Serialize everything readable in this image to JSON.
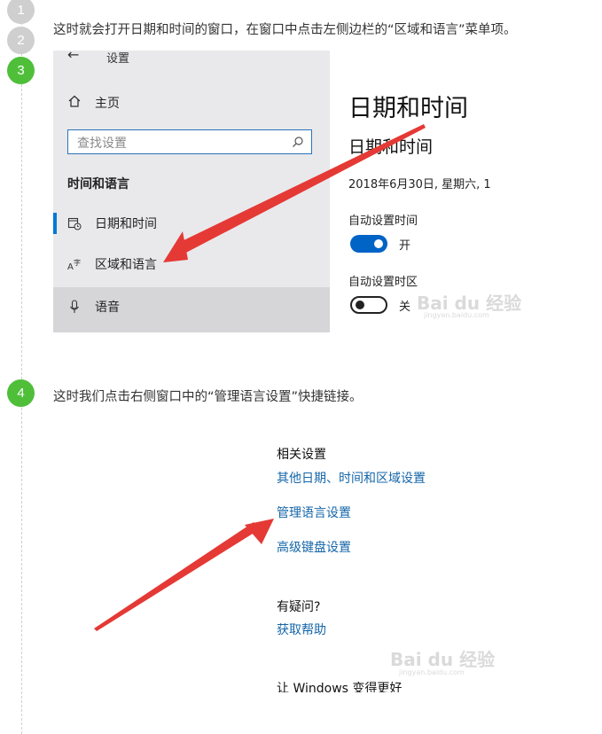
{
  "steps": [
    {
      "number": "1"
    },
    {
      "number": "2"
    },
    {
      "number": "3",
      "instruction": "这时就会打开日期和时间的窗口，在窗口中点击左侧边栏的“区域和语言”菜单项。"
    },
    {
      "number": "4",
      "instruction": "这时我们点击右侧窗口中的“管理语言设置”快捷链接。"
    }
  ],
  "settings_window": {
    "title": "设置",
    "home_label": "主页",
    "search_placeholder": "查找设置",
    "category_title": "时间和语言",
    "nav_items": [
      {
        "label": "日期和时间",
        "icon": "calendar-clock-icon",
        "active": true
      },
      {
        "label": "区域和语言",
        "icon": "region-language-icon"
      },
      {
        "label": "语音",
        "icon": "microphone-icon"
      }
    ]
  },
  "date_time_pane": {
    "heading": "日期和时间",
    "subheading": "日期和时间",
    "current_date": "2018年6月30日, 星期六, 1",
    "auto_time_label": "自动设置时间",
    "auto_time_state": "开",
    "auto_timezone_label": "自动设置时区",
    "auto_timezone_state": "关"
  },
  "related_settings": {
    "heading": "相关设置",
    "links": [
      "其他日期、时间和区域设置",
      "管理语言设置",
      "高级键盘设置"
    ],
    "question_heading": "有疑问?",
    "help_link": "获取帮助",
    "bottom_text": "让 Windows 变得更好"
  },
  "watermark": {
    "text": "Bai du 经验",
    "sub": "jingyan.baidu.com"
  },
  "colors": {
    "accent_blue": "#0078d7",
    "link_blue": "#1566a8",
    "step_green": "#4fbf3a",
    "step_grey": "#cfcfcf",
    "arrow_red": "#e53935"
  }
}
